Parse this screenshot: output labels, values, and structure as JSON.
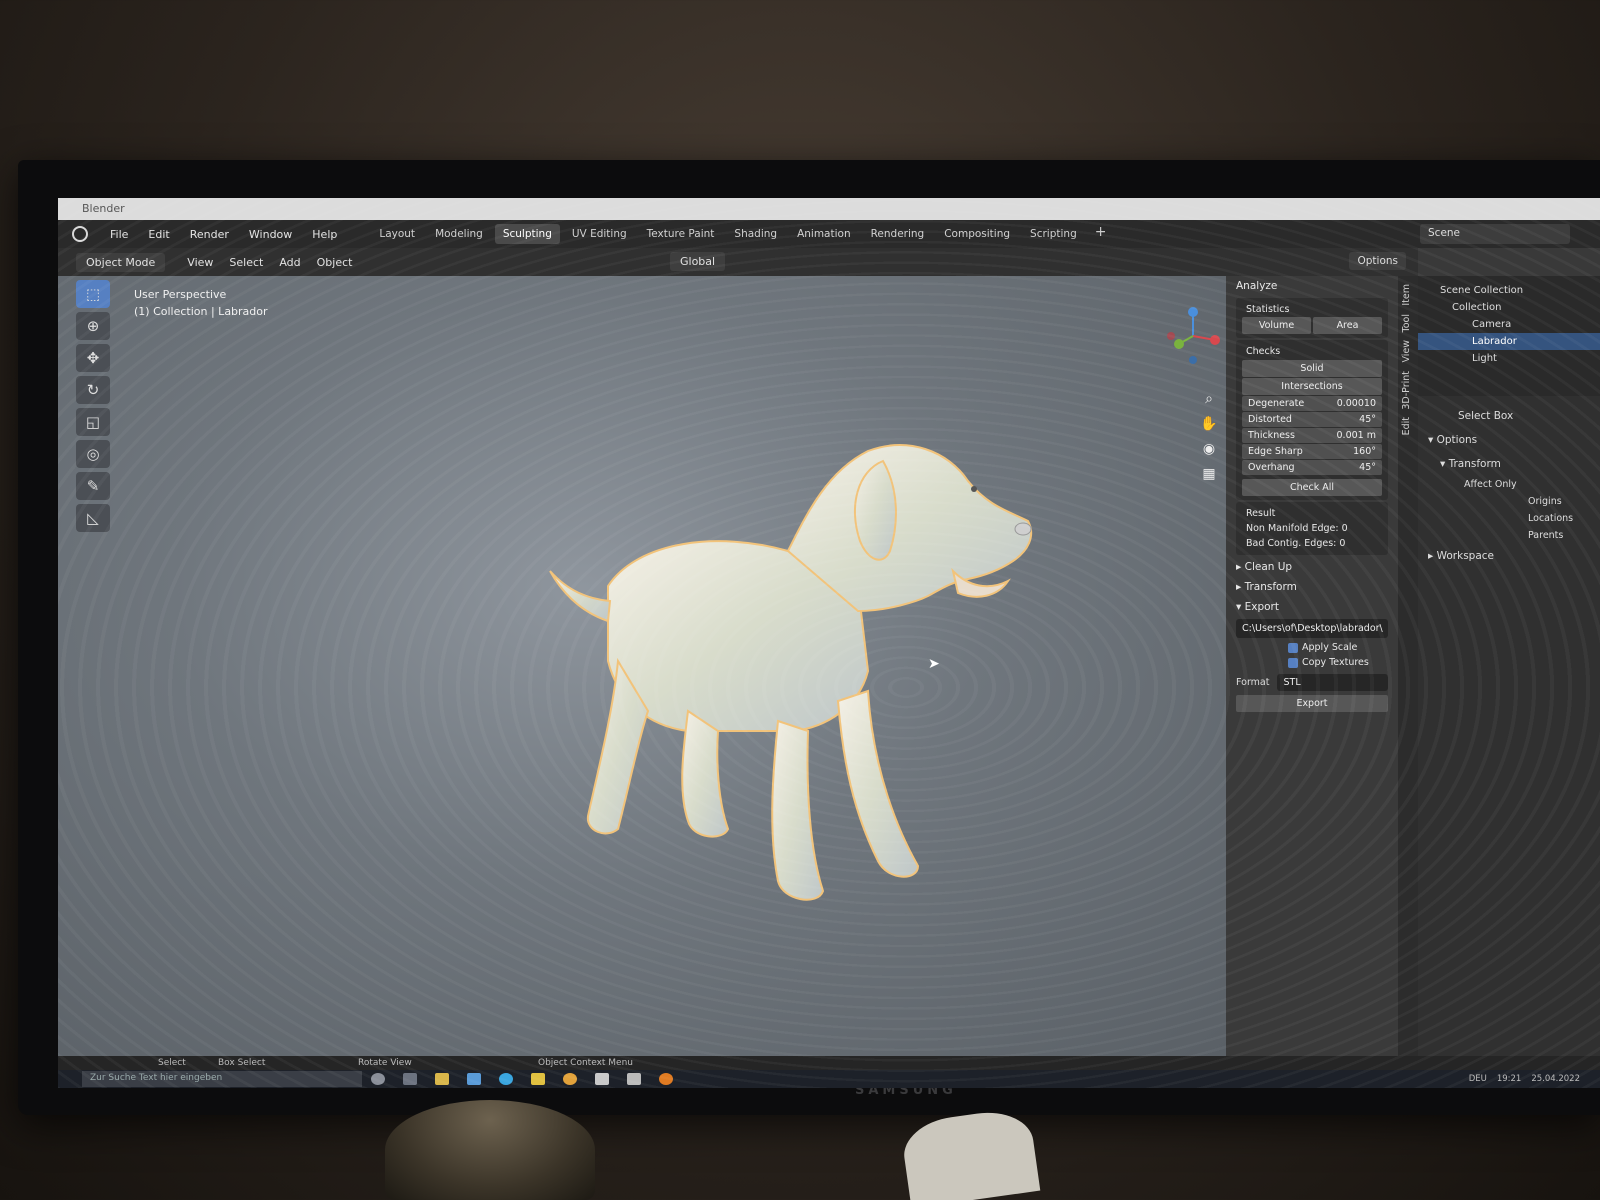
{
  "app": {
    "title": "Blender"
  },
  "menu": [
    "File",
    "Edit",
    "Render",
    "Window",
    "Help"
  ],
  "workspaces": [
    "Layout",
    "Modeling",
    "Sculpting",
    "UV Editing",
    "Texture Paint",
    "Shading",
    "Animation",
    "Rendering",
    "Compositing",
    "Scripting"
  ],
  "active_workspace": "Sculpting",
  "scene": "Scene",
  "header": {
    "mode": "Object Mode",
    "items": [
      "View",
      "Select",
      "Add",
      "Object"
    ],
    "orientation": "Global",
    "options": "Options"
  },
  "viewport": {
    "perspective": "User Perspective",
    "collection": "(1) Collection | Labrador"
  },
  "print3d": {
    "panel_title": "Analyze",
    "statistics_label": "Statistics",
    "stat_buttons": [
      "Volume",
      "Area"
    ],
    "checks_label": "Checks",
    "check_solid": "Solid",
    "check_intersections": "Intersections",
    "checks": [
      {
        "label": "Degenerate",
        "value": "0.00010"
      },
      {
        "label": "Distorted",
        "value": "45°"
      },
      {
        "label": "Thickness",
        "value": "0.001 m"
      },
      {
        "label": "Edge Sharp",
        "value": "160°"
      },
      {
        "label": "Overhang",
        "value": "45°"
      }
    ],
    "check_all": "Check All",
    "result_label": "Result",
    "results": [
      "Non Manifold Edge: 0",
      "Bad Contig. Edges: 0"
    ],
    "cleanup": "Clean Up",
    "transform": "Transform",
    "export_section": "Export",
    "export_path": "C:\\Users\\of\\Desktop\\labrador\\",
    "apply_scale": "Apply Scale",
    "copy_textures": "Copy Textures",
    "format_label": "Format",
    "format_value": "STL",
    "export_button": "Export"
  },
  "side_tabs": [
    "Item",
    "Tool",
    "View",
    "3D-Print",
    "Edit"
  ],
  "outliner": {
    "items": [
      "Scene Collection",
      "Collection",
      "Camera",
      "Labrador",
      "Light"
    ],
    "selected": "Labrador"
  },
  "properties": {
    "tool": "Select Box",
    "options": "Options",
    "transform": "Transform",
    "affect_only": "Affect Only",
    "affect_items": [
      "Origins",
      "Locations",
      "Parents"
    ],
    "workspace": "Workspace"
  },
  "status_bar": {
    "select": "Select",
    "box_select": "Box Select",
    "rotate_view": "Rotate View",
    "context_menu": "Object Context Menu"
  },
  "taskbar": {
    "search_placeholder": "Zur Suche Text hier eingeben",
    "lang": "DEU",
    "time": "19:21",
    "date": "25.04.2022"
  },
  "monitor_brand": "SAMSUNG",
  "colors": {
    "accent": "#5680c2",
    "selected_row": "#35547f",
    "viewport": "#7b838b"
  }
}
